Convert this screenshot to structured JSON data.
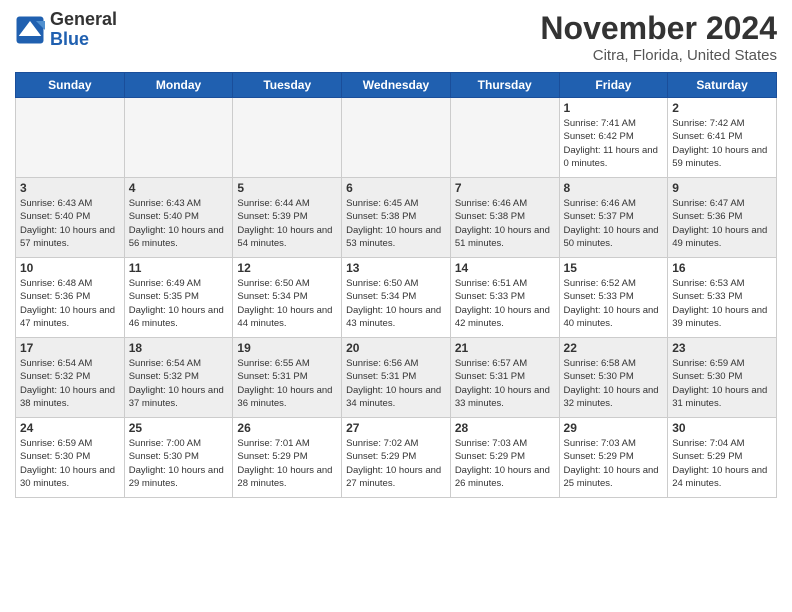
{
  "header": {
    "logo_general": "General",
    "logo_blue": "Blue",
    "month_title": "November 2024",
    "location": "Citra, Florida, United States"
  },
  "days_of_week": [
    "Sunday",
    "Monday",
    "Tuesday",
    "Wednesday",
    "Thursday",
    "Friday",
    "Saturday"
  ],
  "weeks": [
    [
      {
        "day": "",
        "info": ""
      },
      {
        "day": "",
        "info": ""
      },
      {
        "day": "",
        "info": ""
      },
      {
        "day": "",
        "info": ""
      },
      {
        "day": "",
        "info": ""
      },
      {
        "day": "1",
        "info": "Sunrise: 7:41 AM\nSunset: 6:42 PM\nDaylight: 11 hours and 0 minutes."
      },
      {
        "day": "2",
        "info": "Sunrise: 7:42 AM\nSunset: 6:41 PM\nDaylight: 10 hours and 59 minutes."
      }
    ],
    [
      {
        "day": "3",
        "info": "Sunrise: 6:43 AM\nSunset: 5:40 PM\nDaylight: 10 hours and 57 minutes."
      },
      {
        "day": "4",
        "info": "Sunrise: 6:43 AM\nSunset: 5:40 PM\nDaylight: 10 hours and 56 minutes."
      },
      {
        "day": "5",
        "info": "Sunrise: 6:44 AM\nSunset: 5:39 PM\nDaylight: 10 hours and 54 minutes."
      },
      {
        "day": "6",
        "info": "Sunrise: 6:45 AM\nSunset: 5:38 PM\nDaylight: 10 hours and 53 minutes."
      },
      {
        "day": "7",
        "info": "Sunrise: 6:46 AM\nSunset: 5:38 PM\nDaylight: 10 hours and 51 minutes."
      },
      {
        "day": "8",
        "info": "Sunrise: 6:46 AM\nSunset: 5:37 PM\nDaylight: 10 hours and 50 minutes."
      },
      {
        "day": "9",
        "info": "Sunrise: 6:47 AM\nSunset: 5:36 PM\nDaylight: 10 hours and 49 minutes."
      }
    ],
    [
      {
        "day": "10",
        "info": "Sunrise: 6:48 AM\nSunset: 5:36 PM\nDaylight: 10 hours and 47 minutes."
      },
      {
        "day": "11",
        "info": "Sunrise: 6:49 AM\nSunset: 5:35 PM\nDaylight: 10 hours and 46 minutes."
      },
      {
        "day": "12",
        "info": "Sunrise: 6:50 AM\nSunset: 5:34 PM\nDaylight: 10 hours and 44 minutes."
      },
      {
        "day": "13",
        "info": "Sunrise: 6:50 AM\nSunset: 5:34 PM\nDaylight: 10 hours and 43 minutes."
      },
      {
        "day": "14",
        "info": "Sunrise: 6:51 AM\nSunset: 5:33 PM\nDaylight: 10 hours and 42 minutes."
      },
      {
        "day": "15",
        "info": "Sunrise: 6:52 AM\nSunset: 5:33 PM\nDaylight: 10 hours and 40 minutes."
      },
      {
        "day": "16",
        "info": "Sunrise: 6:53 AM\nSunset: 5:33 PM\nDaylight: 10 hours and 39 minutes."
      }
    ],
    [
      {
        "day": "17",
        "info": "Sunrise: 6:54 AM\nSunset: 5:32 PM\nDaylight: 10 hours and 38 minutes."
      },
      {
        "day": "18",
        "info": "Sunrise: 6:54 AM\nSunset: 5:32 PM\nDaylight: 10 hours and 37 minutes."
      },
      {
        "day": "19",
        "info": "Sunrise: 6:55 AM\nSunset: 5:31 PM\nDaylight: 10 hours and 36 minutes."
      },
      {
        "day": "20",
        "info": "Sunrise: 6:56 AM\nSunset: 5:31 PM\nDaylight: 10 hours and 34 minutes."
      },
      {
        "day": "21",
        "info": "Sunrise: 6:57 AM\nSunset: 5:31 PM\nDaylight: 10 hours and 33 minutes."
      },
      {
        "day": "22",
        "info": "Sunrise: 6:58 AM\nSunset: 5:30 PM\nDaylight: 10 hours and 32 minutes."
      },
      {
        "day": "23",
        "info": "Sunrise: 6:59 AM\nSunset: 5:30 PM\nDaylight: 10 hours and 31 minutes."
      }
    ],
    [
      {
        "day": "24",
        "info": "Sunrise: 6:59 AM\nSunset: 5:30 PM\nDaylight: 10 hours and 30 minutes."
      },
      {
        "day": "25",
        "info": "Sunrise: 7:00 AM\nSunset: 5:30 PM\nDaylight: 10 hours and 29 minutes."
      },
      {
        "day": "26",
        "info": "Sunrise: 7:01 AM\nSunset: 5:29 PM\nDaylight: 10 hours and 28 minutes."
      },
      {
        "day": "27",
        "info": "Sunrise: 7:02 AM\nSunset: 5:29 PM\nDaylight: 10 hours and 27 minutes."
      },
      {
        "day": "28",
        "info": "Sunrise: 7:03 AM\nSunset: 5:29 PM\nDaylight: 10 hours and 26 minutes."
      },
      {
        "day": "29",
        "info": "Sunrise: 7:03 AM\nSunset: 5:29 PM\nDaylight: 10 hours and 25 minutes."
      },
      {
        "day": "30",
        "info": "Sunrise: 7:04 AM\nSunset: 5:29 PM\nDaylight: 10 hours and 24 minutes."
      }
    ]
  ]
}
